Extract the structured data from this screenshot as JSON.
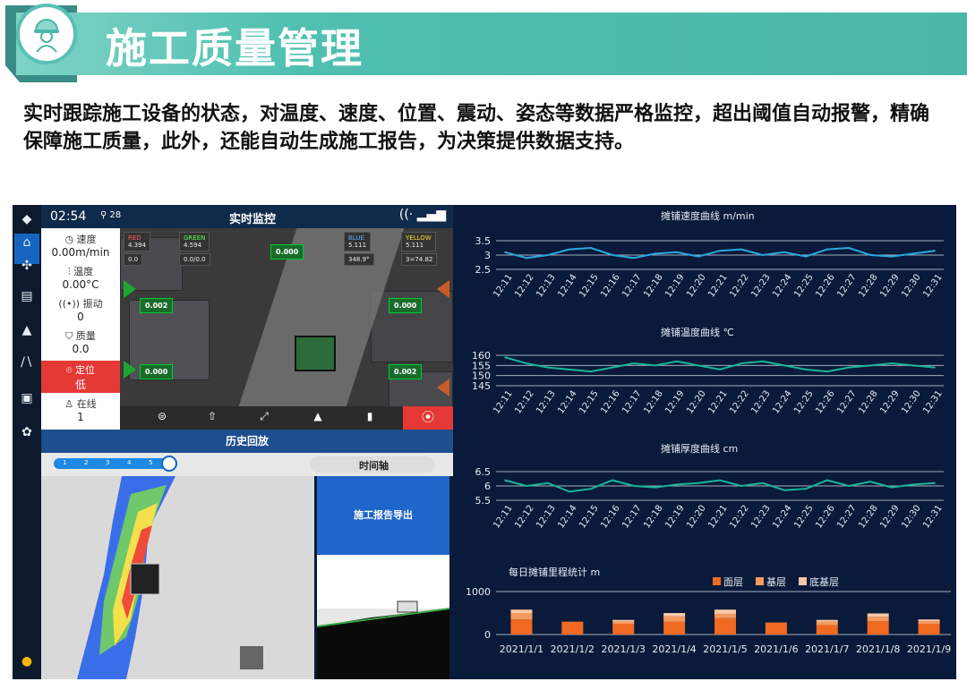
{
  "header": {
    "title": "施工质量管理",
    "description": "实时跟踪施工设备的状态，对温度、速度、位置、震动、姿态等数据严格监控，超出阈值自动报警，精确保障施工质量，此外，还能自动生成施工报告，为决策提供数据支持。"
  },
  "app": {
    "topbar": {
      "time": "02:54",
      "satellites": "28",
      "title": "实时监控"
    },
    "status": {
      "speed_label": "速度",
      "speed_value": "0.00m/min",
      "temp_label": "温度",
      "temp_value": "0.00°C",
      "vibration_label": "振动",
      "vibration_value": "0",
      "quality_label": "质量",
      "quality_value": "0.0",
      "position_label": "定位",
      "position_value": "低",
      "online_label": "在线",
      "online_value": "1"
    },
    "scene_tags": {
      "red_label": "RED",
      "red_value": "4.394",
      "green_label": "GREEN",
      "green_value": "4.594",
      "blue_label": "BLUE",
      "blue_value": "5.111",
      "yellow_label": "YELLOW",
      "yellow_value": "5.111",
      "readout_left": "0.0",
      "readout_mid": "0.0/0.0",
      "readout_heading": "348.9°",
      "readout_right": "3=74.82",
      "tag_top": "0.000",
      "tag_left_1": "0.002",
      "tag_right_1": "0.000",
      "tag_left_2": "0.000",
      "tag_right_2": "0.002"
    },
    "history_title": "历史回放",
    "slider_ticks": [
      "1",
      "2",
      "3",
      "4",
      "5"
    ],
    "timeline_label": "时间轴",
    "export_button": "施工报告导出"
  },
  "colors": {
    "banner": "#4bb7a9",
    "panel_bg": "#0a1a3a",
    "line": "#2aa8e0",
    "line_temp": "#18b59a",
    "bar_surface": "#f06a22",
    "bar_base": "#f49b5e",
    "bar_sub": "#f8c7a6"
  },
  "chart_data": [
    {
      "type": "line",
      "title": "摊铺速度曲线 m/min",
      "x": [
        "12:11",
        "12:12",
        "12:13",
        "12:14",
        "12:15",
        "12:16",
        "12:17",
        "12:18",
        "12:19",
        "12:20",
        "12:21",
        "12:22",
        "12:23",
        "12:24",
        "12:25",
        "12:26",
        "12:27",
        "12:28",
        "12:29",
        "12:30",
        "12:31"
      ],
      "series": [
        {
          "values": [
            3.1,
            2.9,
            3.0,
            3.2,
            3.25,
            3.0,
            2.9,
            3.05,
            3.1,
            2.95,
            3.15,
            3.2,
            3.0,
            3.1,
            2.95,
            3.2,
            3.25,
            3.0,
            2.95,
            3.05,
            3.15
          ]
        }
      ],
      "yticks": [
        "3.5",
        "3",
        "2.5"
      ],
      "ylim": [
        2.5,
        3.5
      ]
    },
    {
      "type": "line",
      "title": "摊铺温度曲线 ℃",
      "x": [
        "12:11",
        "12:12",
        "12:13",
        "12:14",
        "12:15",
        "12:16",
        "12:17",
        "12:18",
        "12:19",
        "12:20",
        "12:21",
        "12:22",
        "12:23",
        "12:24",
        "12:25",
        "12:26",
        "12:27",
        "12:28",
        "12:29",
        "12:30",
        "12:31"
      ],
      "series": [
        {
          "values": [
            159,
            156,
            154,
            153,
            152,
            154,
            156,
            155,
            157,
            155,
            153,
            156,
            157,
            155,
            153,
            152,
            154,
            155,
            156,
            155,
            154
          ]
        }
      ],
      "yticks": [
        "160",
        "155",
        "150",
        "145"
      ],
      "ylim": [
        145,
        160
      ]
    },
    {
      "type": "line",
      "title": "摊铺厚度曲线 cm",
      "x": [
        "12:11",
        "12:12",
        "12:13",
        "12:14",
        "12:15",
        "12:16",
        "12:17",
        "12:18",
        "12:19",
        "12:20",
        "12:21",
        "12:22",
        "12:23",
        "12:24",
        "12:25",
        "12:26",
        "12:27",
        "12:28",
        "12:29",
        "12:30",
        "12:31"
      ],
      "series": [
        {
          "values": [
            6.2,
            6.0,
            6.1,
            5.8,
            5.9,
            6.2,
            6.0,
            5.95,
            6.05,
            6.1,
            6.2,
            6.0,
            6.1,
            5.85,
            5.9,
            6.2,
            6.0,
            6.15,
            5.95,
            6.05,
            6.1
          ]
        }
      ],
      "yticks": [
        "6.5",
        "6",
        "5.5"
      ],
      "ylim": [
        5.5,
        6.5
      ]
    },
    {
      "type": "bar",
      "title": "每日摊铺里程统计 m",
      "categories": [
        "2021/1/1",
        "2021/1/2",
        "2021/1/3",
        "2021/1/4",
        "2021/1/5",
        "2021/1/6",
        "2021/1/7",
        "2021/1/8",
        "2021/1/9"
      ],
      "series": [
        {
          "name": "面层",
          "values": [
            350,
            300,
            250,
            300,
            380,
            280,
            220,
            310,
            250
          ]
        },
        {
          "name": "基层",
          "values": [
            150,
            0,
            50,
            120,
            100,
            0,
            80,
            100,
            60
          ]
        },
        {
          "name": "底基层",
          "values": [
            80,
            0,
            40,
            80,
            100,
            0,
            40,
            80,
            40
          ]
        }
      ],
      "yticks": [
        "1000",
        "0"
      ],
      "ylim": [
        0,
        1000
      ]
    }
  ]
}
